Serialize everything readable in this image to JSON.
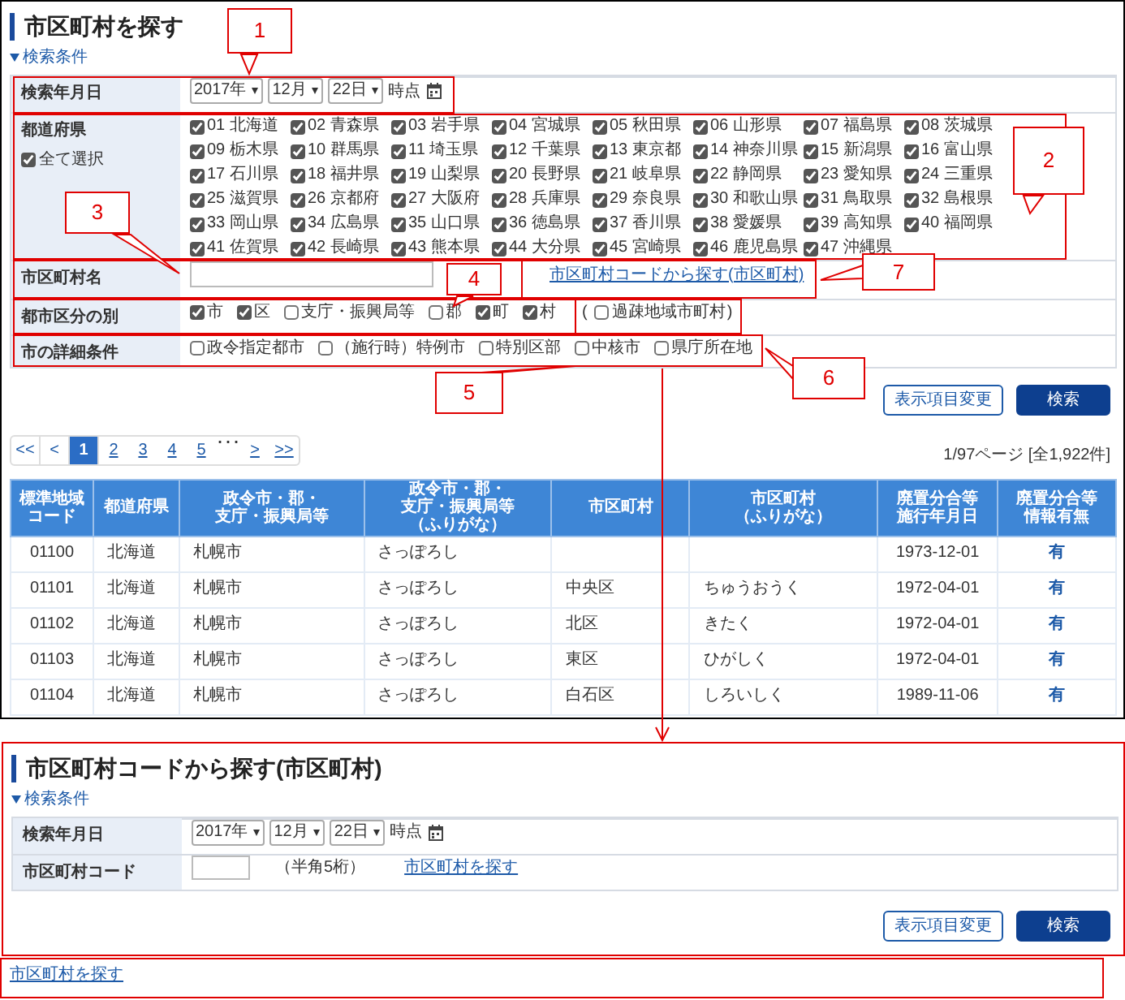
{
  "search_panel": {
    "title": "市区町村を探す",
    "toggle": "検索条件",
    "form": [
      {
        "kind": "date",
        "label": "検索年月日",
        "year": "2017年",
        "month": "12月",
        "day": "22日",
        "suffix": "時点"
      },
      {
        "kind": "prefectures",
        "label": "都道府県",
        "select_all": {
          "label": "全て選択",
          "checked": true
        },
        "items": [
          {
            "label": "01 北海道",
            "checked": true
          },
          {
            "label": "02 青森県",
            "checked": true
          },
          {
            "label": "03 岩手県",
            "checked": true
          },
          {
            "label": "04 宮城県",
            "checked": true
          },
          {
            "label": "05 秋田県",
            "checked": true
          },
          {
            "label": "06 山形県",
            "checked": true
          },
          {
            "label": "07 福島県",
            "checked": true
          },
          {
            "label": "08 茨城県",
            "checked": true
          },
          {
            "label": "09 栃木県",
            "checked": true
          },
          {
            "label": "10 群馬県",
            "checked": true
          },
          {
            "label": "11 埼玉県",
            "checked": true
          },
          {
            "label": "12 千葉県",
            "checked": true
          },
          {
            "label": "13 東京都",
            "checked": true
          },
          {
            "label": "14 神奈川県",
            "checked": true
          },
          {
            "label": "15 新潟県",
            "checked": true
          },
          {
            "label": "16 富山県",
            "checked": true
          },
          {
            "label": "17 石川県",
            "checked": true
          },
          {
            "label": "18 福井県",
            "checked": true
          },
          {
            "label": "19 山梨県",
            "checked": true
          },
          {
            "label": "20 長野県",
            "checked": true
          },
          {
            "label": "21 岐阜県",
            "checked": true
          },
          {
            "label": "22 静岡県",
            "checked": true
          },
          {
            "label": "23 愛知県",
            "checked": true
          },
          {
            "label": "24 三重県",
            "checked": true
          },
          {
            "label": "25 滋賀県",
            "checked": true
          },
          {
            "label": "26 京都府",
            "checked": true
          },
          {
            "label": "27 大阪府",
            "checked": true
          },
          {
            "label": "28 兵庫県",
            "checked": true
          },
          {
            "label": "29 奈良県",
            "checked": true
          },
          {
            "label": "30 和歌山県",
            "checked": true
          },
          {
            "label": "31 鳥取県",
            "checked": true
          },
          {
            "label": "32 島根県",
            "checked": true
          },
          {
            "label": "33 岡山県",
            "checked": true
          },
          {
            "label": "34 広島県",
            "checked": true
          },
          {
            "label": "35 山口県",
            "checked": true
          },
          {
            "label": "36 徳島県",
            "checked": true
          },
          {
            "label": "37 香川県",
            "checked": true
          },
          {
            "label": "38 愛媛県",
            "checked": true
          },
          {
            "label": "39 高知県",
            "checked": true
          },
          {
            "label": "40 福岡県",
            "checked": true
          },
          {
            "label": "41 佐賀県",
            "checked": true
          },
          {
            "label": "42 長崎県",
            "checked": true
          },
          {
            "label": "43 熊本県",
            "checked": true
          },
          {
            "label": "44 大分県",
            "checked": true
          },
          {
            "label": "45 宮崎県",
            "checked": true
          },
          {
            "label": "46 鹿児島県",
            "checked": true
          },
          {
            "label": "47 沖縄県",
            "checked": true
          }
        ]
      },
      {
        "kind": "name",
        "label": "市区町村名",
        "link": "市区町村コードから探す(市区町村)"
      },
      {
        "kind": "checks",
        "label": "都市区分の別",
        "options": [
          {
            "label": "市",
            "checked": true
          },
          {
            "label": "区",
            "checked": true
          },
          {
            "label": "支庁・振興局等",
            "checked": false
          },
          {
            "label": "郡",
            "checked": false
          },
          {
            "label": "町",
            "checked": true
          },
          {
            "label": "村",
            "checked": true
          }
        ],
        "extra": {
          "open": "(",
          "label": "過疎地域市町村",
          "checked": false,
          "close": ")"
        }
      },
      {
        "kind": "checks",
        "label": "市の詳細条件",
        "options": [
          {
            "label": "政令指定都市",
            "checked": false
          },
          {
            "label": "（施行時）特例市",
            "checked": false
          },
          {
            "label": "特別区部",
            "checked": false
          },
          {
            "label": "中核市",
            "checked": false
          },
          {
            "label": "県庁所在地",
            "checked": false
          }
        ]
      }
    ],
    "buttons": [
      {
        "label": "表示項目変更",
        "kind": "outline"
      },
      {
        "label": "検索",
        "kind": "primary"
      }
    ],
    "pagination": [
      {
        "text": "<<",
        "kind": "box",
        "selected": false
      },
      {
        "text": "<",
        "kind": "box",
        "selected": false
      },
      {
        "text": "1",
        "kind": "box",
        "selected": true
      },
      {
        "text": "2",
        "kind": "link",
        "selected": false
      },
      {
        "text": "3",
        "kind": "link",
        "selected": false
      },
      {
        "text": "4",
        "kind": "link",
        "selected": false
      },
      {
        "text": "5",
        "kind": "link",
        "selected": false
      },
      {
        "text": "･･･",
        "kind": "ellipsis",
        "selected": false
      },
      {
        "text": ">",
        "kind": "link",
        "selected": false
      },
      {
        "text": ">>",
        "kind": "link",
        "selected": false
      }
    ],
    "page_info": "1/97ページ [全1,922件]",
    "table": {
      "columns": [
        {
          "lines": [
            "標準地域",
            "コード"
          ]
        },
        {
          "lines": [
            "都道府県"
          ]
        },
        {
          "lines": [
            "政令市・郡・",
            "支庁・振興局等"
          ]
        },
        {
          "lines": [
            "政令市・郡・",
            "支庁・振興局等",
            "（ふりがな）"
          ]
        },
        {
          "lines": [
            "市区町村"
          ]
        },
        {
          "lines": [
            "市区町村",
            "（ふりがな）"
          ]
        },
        {
          "lines": [
            "廃置分合等",
            "施行年月日"
          ]
        },
        {
          "lines": [
            "廃置分合等",
            "情報有無"
          ]
        }
      ],
      "rows": [
        [
          "01100",
          "北海道",
          "札幌市",
          "さっぽろし",
          "",
          "",
          "1973-12-01",
          "有"
        ],
        [
          "01101",
          "北海道",
          "札幌市",
          "さっぽろし",
          "中央区",
          "ちゅうおうく",
          "1972-04-01",
          "有"
        ],
        [
          "01102",
          "北海道",
          "札幌市",
          "さっぽろし",
          "北区",
          "きたく",
          "1972-04-01",
          "有"
        ],
        [
          "01103",
          "北海道",
          "札幌市",
          "さっぽろし",
          "東区",
          "ひがしく",
          "1972-04-01",
          "有"
        ],
        [
          "01104",
          "北海道",
          "札幌市",
          "さっぽろし",
          "白石区",
          "しろいしく",
          "1989-11-06",
          "有"
        ]
      ]
    }
  },
  "code_panel": {
    "title": "市区町村コードから探す(市区町村)",
    "toggle": "検索条件",
    "form": [
      {
        "kind": "date",
        "label": "検索年月日",
        "year": "2017年",
        "month": "12月",
        "day": "22日",
        "suffix": "時点"
      },
      {
        "kind": "code",
        "label": "市区町村コード",
        "hint": "（半角5桁）",
        "link": "市区町村を探す"
      }
    ],
    "buttons": [
      {
        "label": "表示項目変更",
        "kind": "outline"
      },
      {
        "label": "検索",
        "kind": "primary"
      }
    ]
  },
  "footer_link": "市区町村を探す",
  "callouts": [
    {
      "number": "1"
    },
    {
      "number": "2"
    },
    {
      "number": "3"
    },
    {
      "number": "4"
    },
    {
      "number": "5"
    },
    {
      "number": "6"
    },
    {
      "number": "7"
    }
  ]
}
